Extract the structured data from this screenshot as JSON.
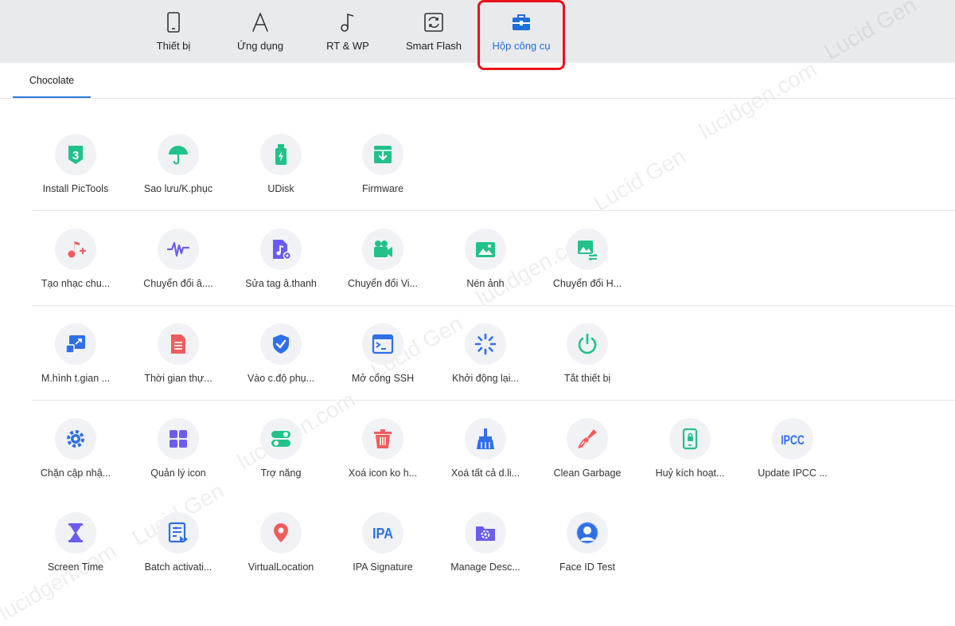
{
  "nav": [
    {
      "label": "Thiết bị",
      "icon": "phone-icon"
    },
    {
      "label": "Ứng dụng",
      "icon": "app-store-icon"
    },
    {
      "label": "RT & WP",
      "icon": "music-note-icon"
    },
    {
      "label": "Smart Flash",
      "icon": "flash-refresh-icon"
    },
    {
      "label": "Hộp công cụ",
      "icon": "toolbox-icon",
      "active": true
    }
  ],
  "subtab": {
    "label": "Chocolate"
  },
  "colors": {
    "accent": "#1e6fd9",
    "highlight_box": "#e8131b",
    "green": "#21c28a",
    "red": "#f25c5c",
    "purple": "#6b5cf0",
    "blue": "#2f6fe8"
  },
  "tools": {
    "row1": [
      {
        "label": "Install PicTools",
        "icon": "three-shield-icon"
      },
      {
        "label": "Sao lưu/K.phục",
        "icon": "umbrella-icon"
      },
      {
        "label": "UDisk",
        "icon": "usb-drive-icon"
      },
      {
        "label": "Firmware",
        "icon": "download-box-icon"
      }
    ],
    "row2": [
      {
        "label": "Tạo nhạc chu...",
        "icon": "music-plus-icon"
      },
      {
        "label": "Chuyển đổi â....",
        "icon": "audio-wave-icon"
      },
      {
        "label": "Sửa tag â.thanh",
        "icon": "music-file-gear-icon"
      },
      {
        "label": "Chuyển đổi Vi...",
        "icon": "video-camera-icon"
      },
      {
        "label": "Nén ảnh",
        "icon": "image-icon"
      },
      {
        "label": "Chuyển đổi H...",
        "icon": "image-convert-icon"
      }
    ],
    "row3": [
      {
        "label": "M.hình t.gian ...",
        "icon": "screen-mirror-icon"
      },
      {
        "label": "Thời gian thự...",
        "icon": "document-icon"
      },
      {
        "label": "Vào c.độ phụ...",
        "icon": "shield-check-icon"
      },
      {
        "label": "Mở cổng SSH",
        "icon": "terminal-icon"
      },
      {
        "label": "Khởi động lại...",
        "icon": "spinner-icon"
      },
      {
        "label": "Tắt thiết bị",
        "icon": "power-icon"
      }
    ],
    "row4": [
      {
        "label": "Chặn cập nhậ...",
        "icon": "gear-icon"
      },
      {
        "label": "Quản lý icon",
        "icon": "grid-icon"
      },
      {
        "label": "Trợ năng",
        "icon": "toggle-icon"
      },
      {
        "label": "Xoá icon ko h...",
        "icon": "trash-icon"
      },
      {
        "label": "Xoá tất cả d.li...",
        "icon": "broom-icon"
      },
      {
        "label": "Clean Garbage",
        "icon": "brush-icon"
      },
      {
        "label": "Huỷ kích hoạt...",
        "icon": "phone-lock-icon"
      },
      {
        "label": "Update IPCC ...",
        "icon": "ipcc-text-icon",
        "text": "IPCC"
      }
    ],
    "row5": [
      {
        "label": "Screen Time",
        "icon": "hourglass-icon"
      },
      {
        "label": "Batch activati...",
        "icon": "batch-list-icon"
      },
      {
        "label": "VirtualLocation",
        "icon": "location-pin-icon"
      },
      {
        "label": "IPA Signature",
        "icon": "ipa-text-icon",
        "text": "IPA"
      },
      {
        "label": "Manage Desc...",
        "icon": "folder-gear-icon"
      },
      {
        "label": "Face ID Test",
        "icon": "face-id-icon"
      }
    ]
  },
  "watermarks": [
    "Lucid Gen",
    "lucidgen.com"
  ]
}
